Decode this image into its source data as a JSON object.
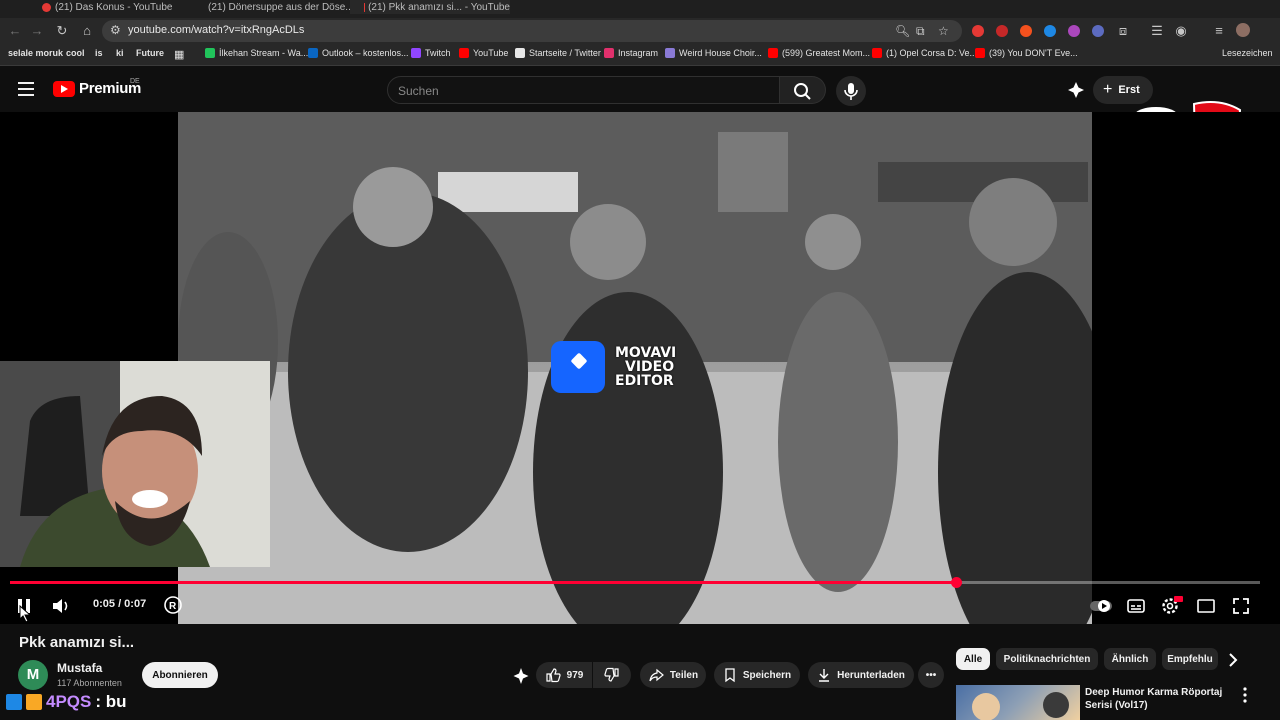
{
  "browser": {
    "tabs": [
      {
        "label": "(21) Das Konus - YouTube"
      },
      {
        "label": "(21) Dönersuppe aus der Döse..."
      },
      {
        "label": "(21) Pkk anamızı si... - YouTube"
      }
    ],
    "url": "youtube.com/watch?v=itxRngAcDLs",
    "bookmarks": [
      {
        "label": "selale moruk",
        "color": "#3a3a3a"
      },
      {
        "label": "cool",
        "color": "#3a3a3a"
      },
      {
        "label": "is",
        "color": "#3a3a3a"
      },
      {
        "label": "ki",
        "color": "#3a3a3a"
      },
      {
        "label": "Future",
        "color": "#3a3a3a"
      },
      {
        "label": "İlkehan Stream - Wa...",
        "color": "#21c45b"
      },
      {
        "label": "Outlook – kostenlos...",
        "color": "#0a66c2"
      },
      {
        "label": "Twitch",
        "color": "#9146ff"
      },
      {
        "label": "YouTube",
        "color": "#ff0000"
      },
      {
        "label": "Startseite / Twitter",
        "color": "#e7e7e7"
      },
      {
        "label": "Instagram",
        "color": "#e1306c"
      },
      {
        "label": "Weird House Choir...",
        "color": "#8a7ad6"
      },
      {
        "label": "(599) Greatest Mom...",
        "color": "#ff0000"
      },
      {
        "label": "(1) Opel Corsa D: Ve...",
        "color": "#ff0000"
      },
      {
        "label": "(39) You DON'T Eve...",
        "color": "#ff0000"
      },
      {
        "label": "Lesezeichen",
        "color": "#282828"
      }
    ]
  },
  "header": {
    "brand": "Premium",
    "region": "DE",
    "search_placeholder": "Suchen",
    "create_label": "Erst"
  },
  "player": {
    "time": "0:05 / 0:07",
    "progress": 0.757,
    "watermark_lines": [
      "MOVAVI",
      "VIDEO",
      "EDITOR"
    ]
  },
  "video": {
    "title": "Pkk anamızı si...",
    "channel_initial": "M",
    "channel": "Mustafa",
    "subscribers": "117 Abonnenten",
    "subscribe_label": "Abonnieren",
    "likes": "979",
    "share_label": "Teilen",
    "save_label": "Speichern",
    "download_label": "Herunterladen"
  },
  "sidebar": {
    "chips": [
      "Alle",
      "Politiknachrichten",
      "Ähnlich",
      "Empfehlu"
    ],
    "rec_title": "Deep Humor Karma Röportaj Serisi (Vol17)"
  },
  "overlay": {
    "name": "4PQS",
    "message": ": bu"
  }
}
